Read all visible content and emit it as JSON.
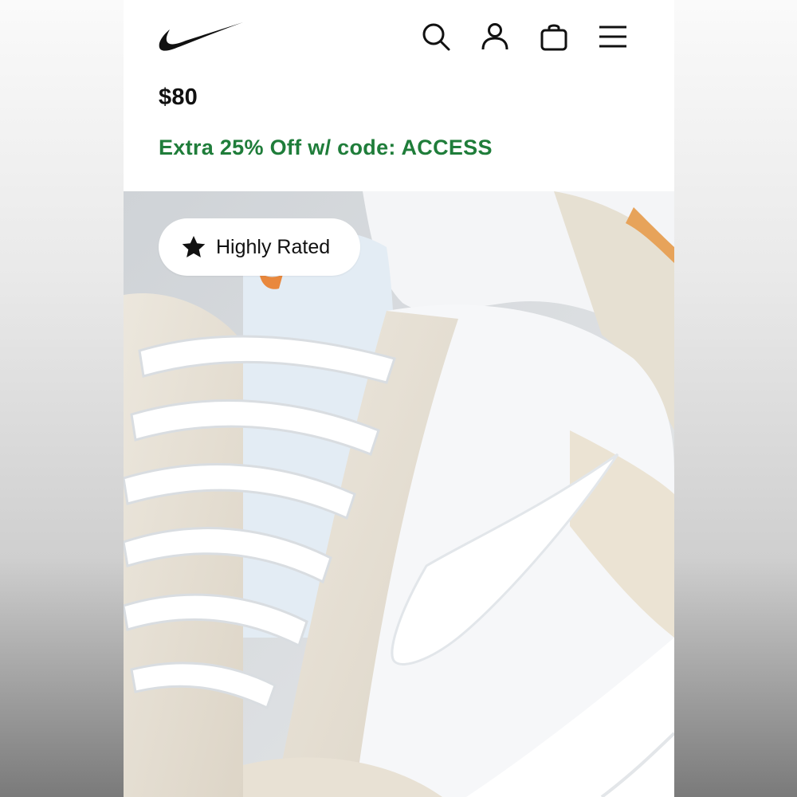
{
  "header": {
    "logo_icon": "nike-swoosh-logo",
    "icons": [
      "search-icon",
      "account-icon",
      "bag-icon",
      "menu-icon"
    ]
  },
  "product": {
    "price": "$80",
    "promo_text": "Extra 25% Off w/ code: ACCESS",
    "badge_label": "Highly Rated",
    "badge_icon": "star-icon"
  },
  "colors": {
    "promo_green": "#1f7d3a",
    "text": "#111111",
    "image_background": "#d7dbdf"
  }
}
